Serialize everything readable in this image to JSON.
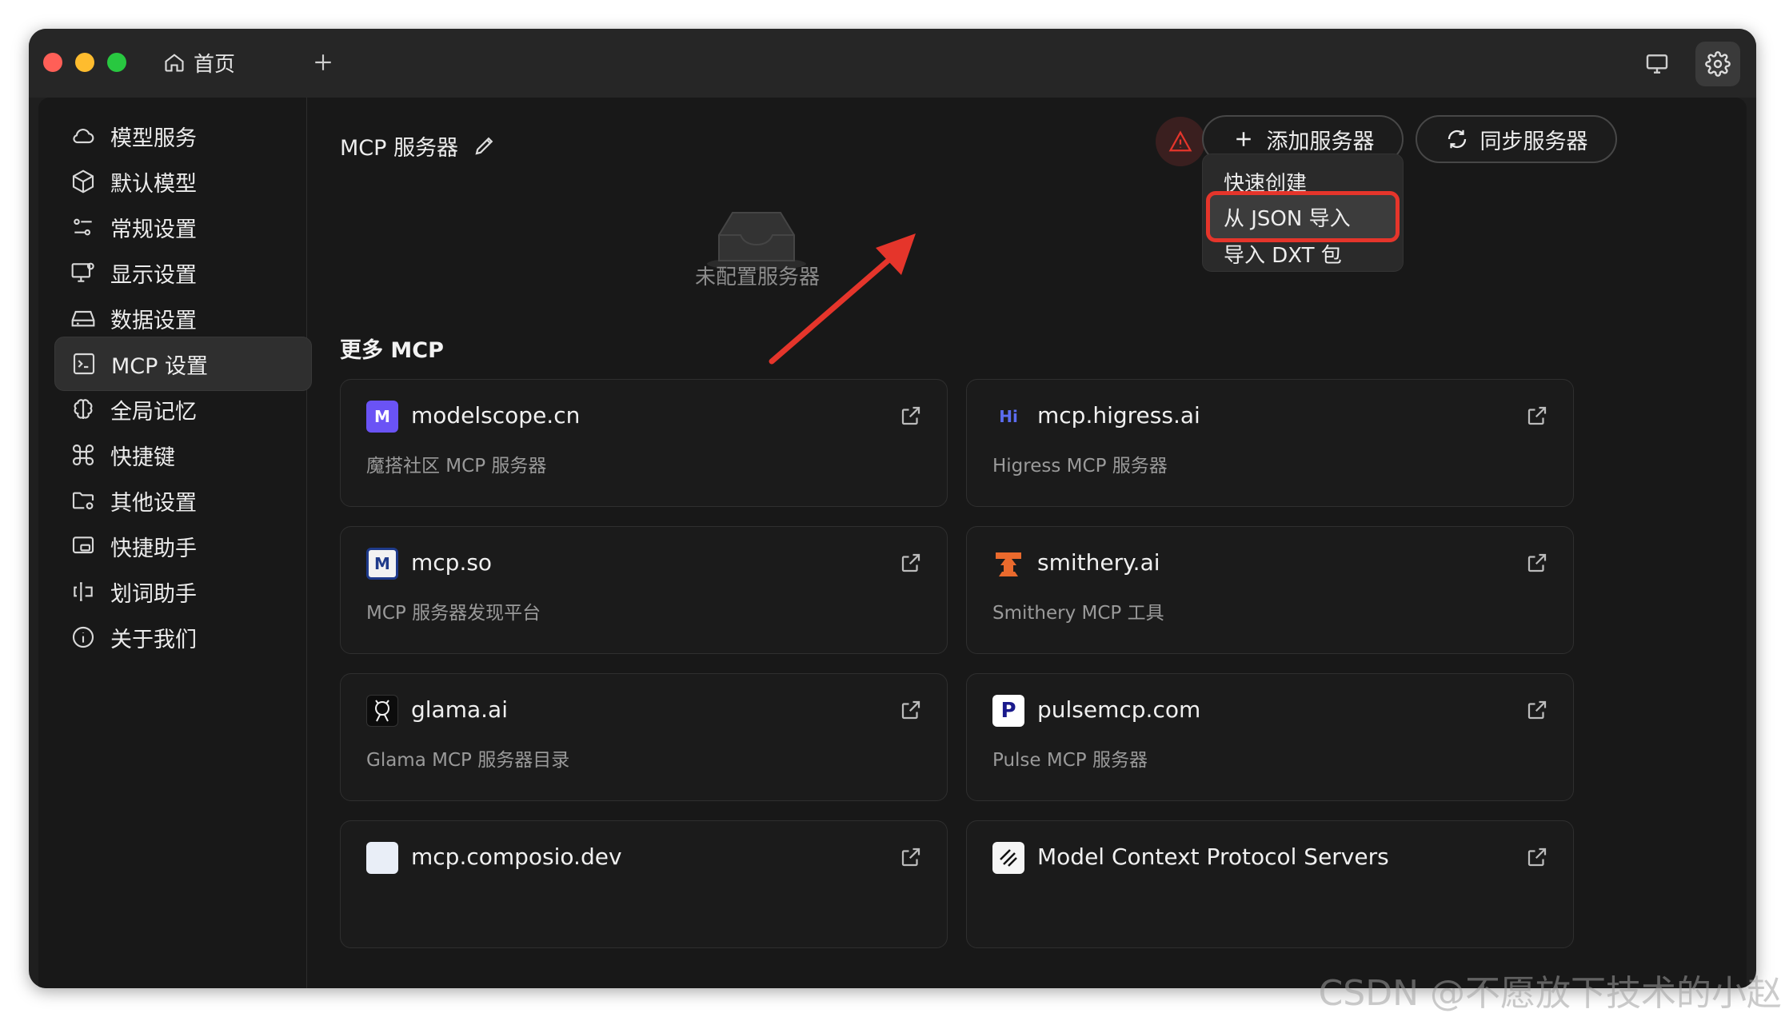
{
  "titlebar": {
    "home_tab": "首页"
  },
  "sidebar": {
    "items": [
      {
        "label": "模型服务",
        "icon": "cloud-icon"
      },
      {
        "label": "默认模型",
        "icon": "cube-icon"
      },
      {
        "label": "常规设置",
        "icon": "sliders-icon"
      },
      {
        "label": "显示设置",
        "icon": "monitor-settings-icon"
      },
      {
        "label": "数据设置",
        "icon": "drive-icon"
      },
      {
        "label": "MCP 设置",
        "icon": "terminal-icon",
        "active": true
      },
      {
        "label": "全局记忆",
        "icon": "brain-icon"
      },
      {
        "label": "快捷键",
        "icon": "command-icon"
      },
      {
        "label": "其他设置",
        "icon": "folder-settings-icon"
      },
      {
        "label": "快捷助手",
        "icon": "window-icon"
      },
      {
        "label": "划词助手",
        "icon": "text-cursor-icon"
      },
      {
        "label": "关于我们",
        "icon": "info-icon"
      }
    ]
  },
  "main": {
    "title": "MCP 服务器",
    "add_button": "添加服务器",
    "sync_button": "同步服务器",
    "dropdown": [
      "快速创建",
      "从 JSON 导入",
      "导入 DXT 包"
    ],
    "empty_text": "未配置服务器",
    "more_title": "更多 MCP",
    "cards": [
      {
        "name": "modelscope.cn",
        "desc": "魔搭社区 MCP 服务器"
      },
      {
        "name": "mcp.higress.ai",
        "desc": "Higress MCP 服务器"
      },
      {
        "name": "mcp.so",
        "desc": "MCP 服务器发现平台"
      },
      {
        "name": "smithery.ai",
        "desc": "Smithery MCP 工具"
      },
      {
        "name": "glama.ai",
        "desc": "Glama MCP 服务器目录"
      },
      {
        "name": "pulsemcp.com",
        "desc": "Pulse MCP 服务器"
      },
      {
        "name": "mcp.composio.dev",
        "desc": ""
      },
      {
        "name": "Model Context Protocol Servers",
        "desc": ""
      }
    ]
  },
  "watermark": "CSDN @不愿放下技术的小赵",
  "colors": {
    "accent_red": "#e5352b",
    "bg": "#181818"
  }
}
